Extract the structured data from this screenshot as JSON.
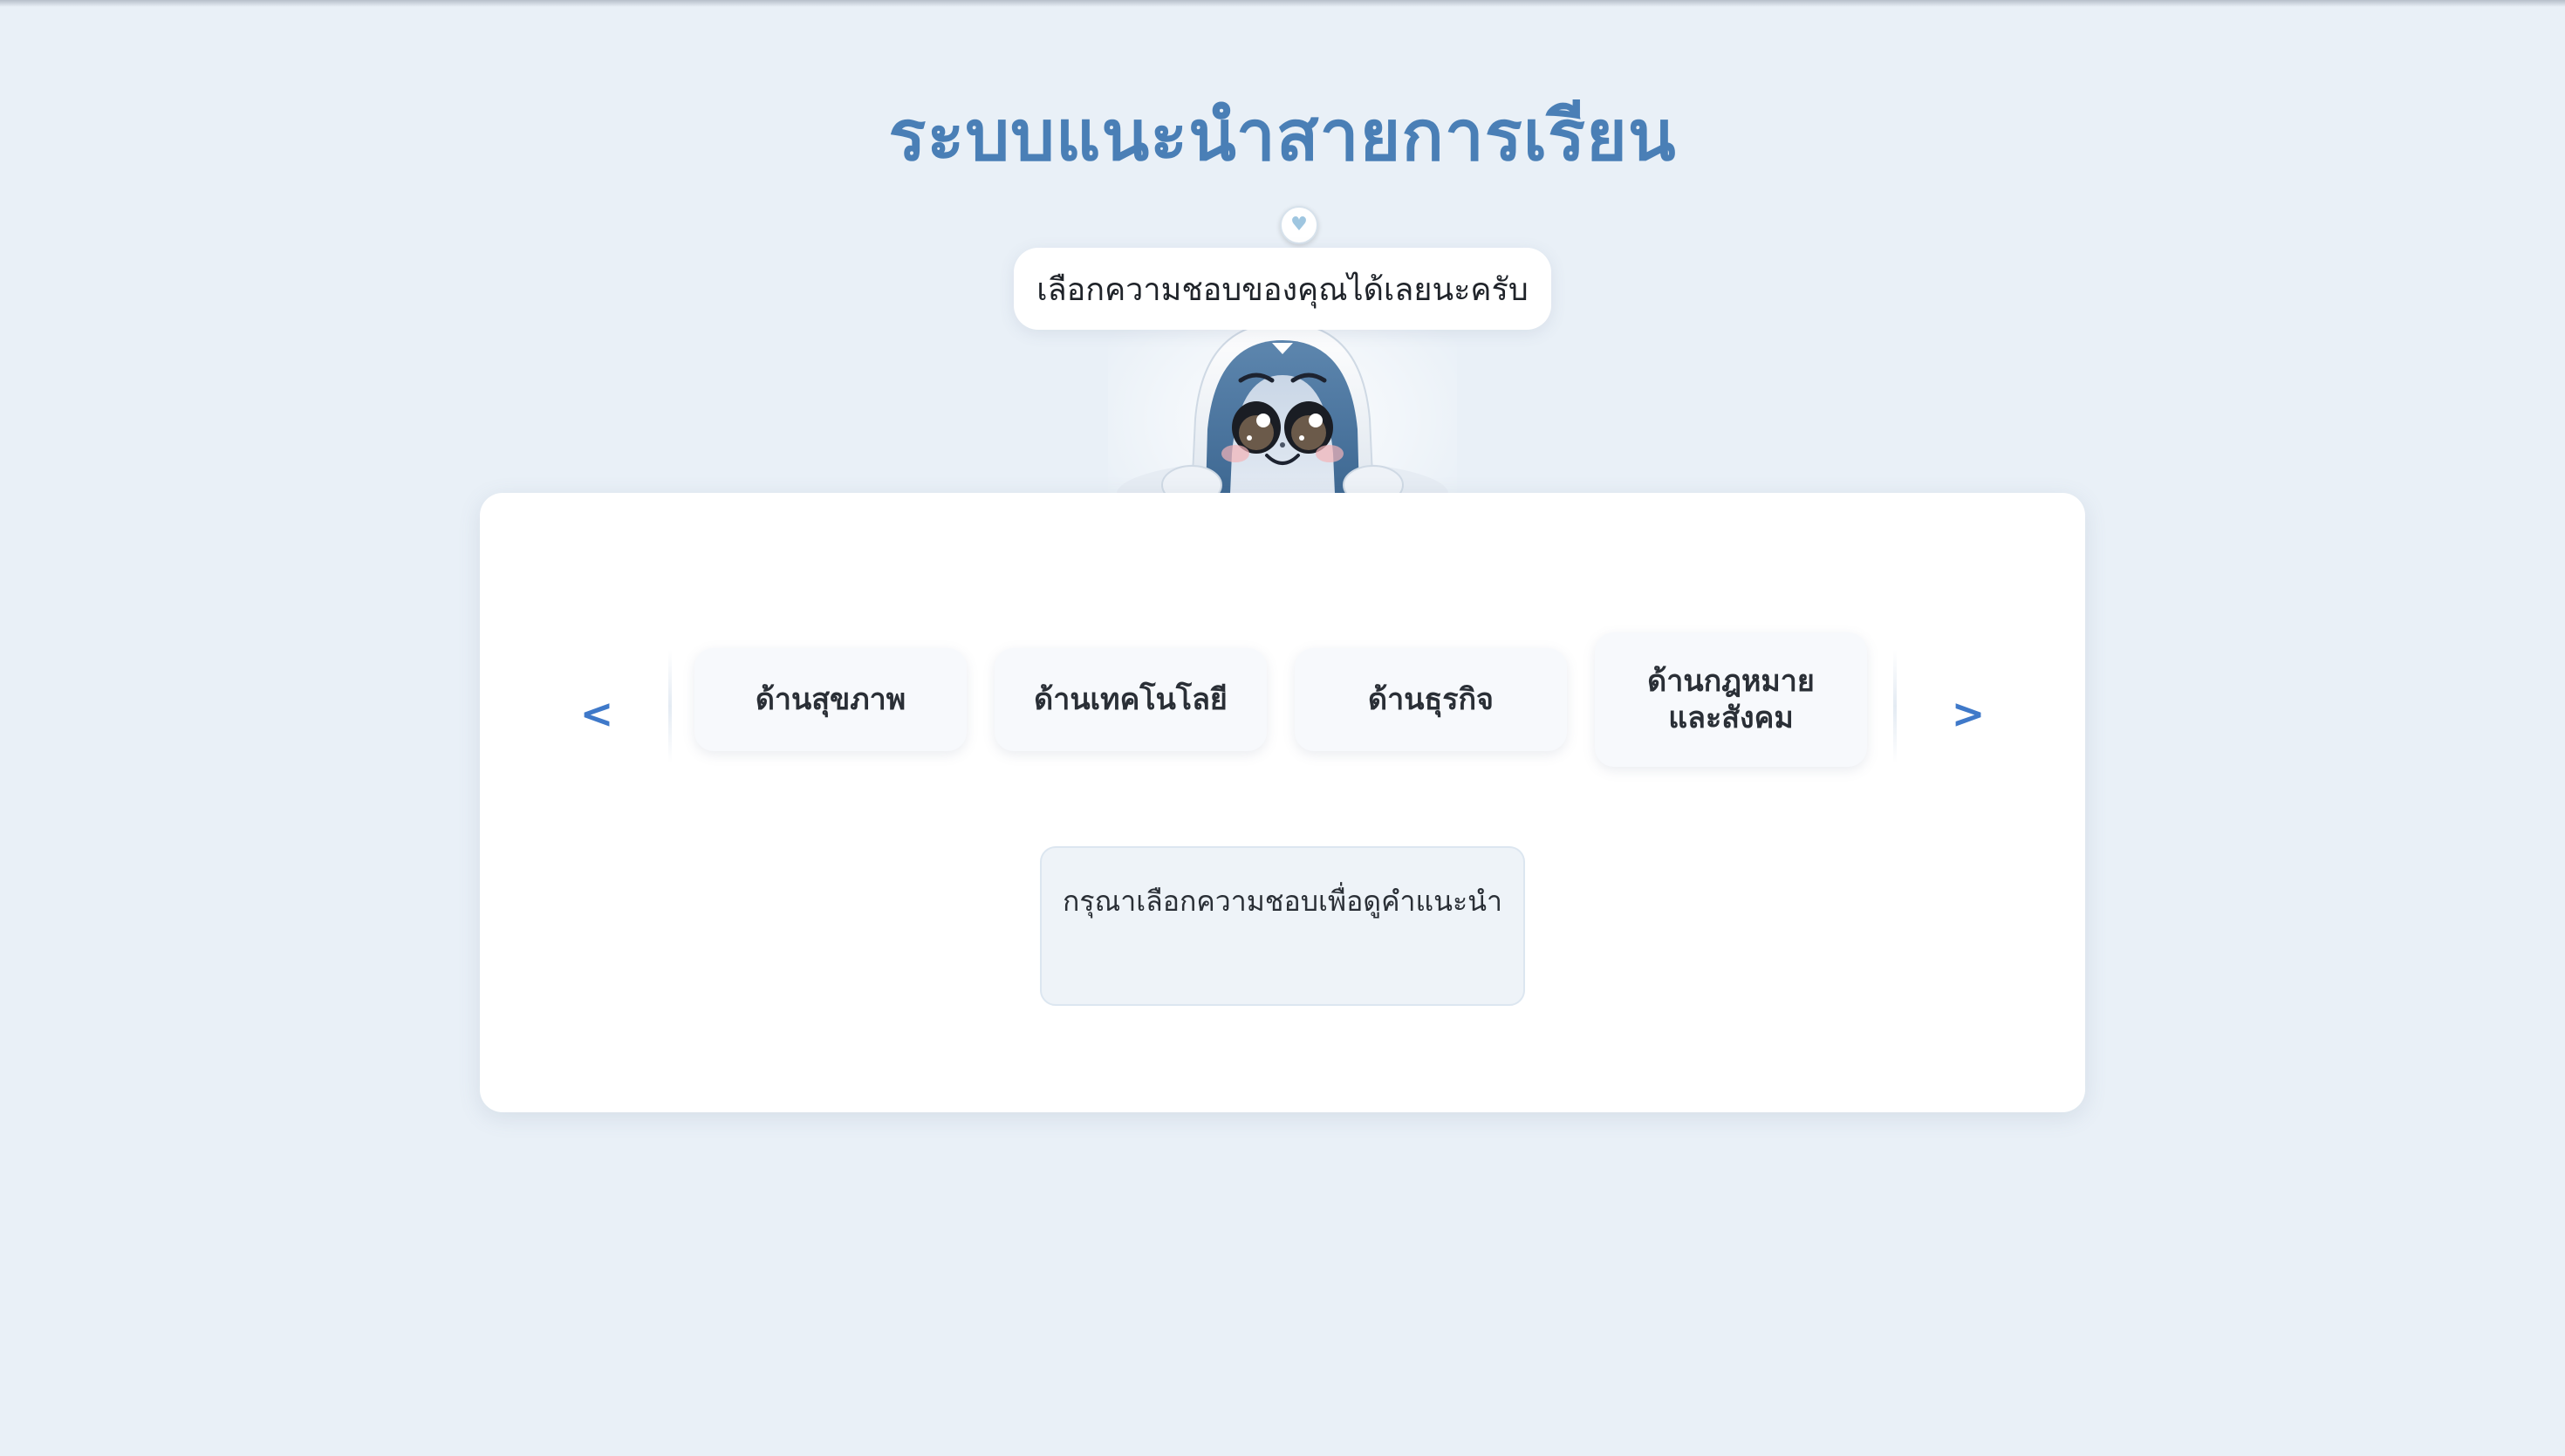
{
  "app": {
    "title": "ระบบแนะนำสายการเรียน"
  },
  "mascot": {
    "speech": "เลือกความชอบของคุณได้เลยนะครับ",
    "badge_icon": "heart-icon"
  },
  "carousel": {
    "prev_label": "<",
    "next_label": ">",
    "categories": [
      {
        "label": "ด้านสุขภาพ"
      },
      {
        "label": "ด้านเทคโนโลยี"
      },
      {
        "label": "ด้านธุรกิจ"
      },
      {
        "label": "ด้านกฎหมายและสังคม"
      }
    ]
  },
  "result": {
    "placeholder": "กรุณาเลือกความชอบเพื่อดูคำแนะนำ"
  },
  "colors": {
    "background": "#e9f0f7",
    "title": "#4a7fb6",
    "arrow": "#3f79c9",
    "card": "#ffffff"
  }
}
